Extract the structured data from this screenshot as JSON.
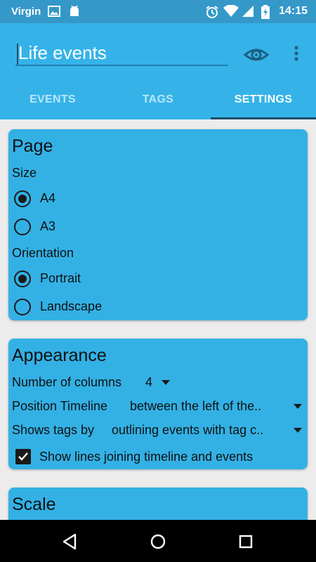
{
  "status_bar": {
    "carrier": "Virgin",
    "time": "14:15",
    "icons": [
      "image-icon",
      "android-icon",
      "alarm-icon",
      "wifi-icon",
      "signal-icon",
      "battery-icon"
    ]
  },
  "app_bar": {
    "title_value": "Life events",
    "actions": [
      "eye-icon",
      "more-vert-icon"
    ]
  },
  "tabs": [
    {
      "label": "EVENTS",
      "active": false
    },
    {
      "label": "TAGS",
      "active": false
    },
    {
      "label": "SETTINGS",
      "active": true
    }
  ],
  "page_card": {
    "title": "Page",
    "size_label": "Size",
    "size_options": [
      {
        "label": "A4",
        "selected": true
      },
      {
        "label": "A3",
        "selected": false
      }
    ],
    "orientation_label": "Orientation",
    "orientation_options": [
      {
        "label": "Portrait",
        "selected": true
      },
      {
        "label": "Landscape",
        "selected": false
      }
    ]
  },
  "appearance_card": {
    "title": "Appearance",
    "columns_label": "Number of columns",
    "columns_value": "4",
    "timeline_label": "Position Timeline",
    "timeline_value": "between the left of the..",
    "tags_label": "Shows tags by",
    "tags_value": "outlining events with tag c..",
    "show_lines_label": "Show lines joining timeline and events",
    "show_lines_checked": true
  },
  "scale_card": {
    "title": "Scale"
  },
  "colors": {
    "status_bar": "#3498c9",
    "app_bar": "#35b3e8",
    "card": "#33b1e5",
    "background": "#ececec",
    "nav_bar": "#000000"
  }
}
